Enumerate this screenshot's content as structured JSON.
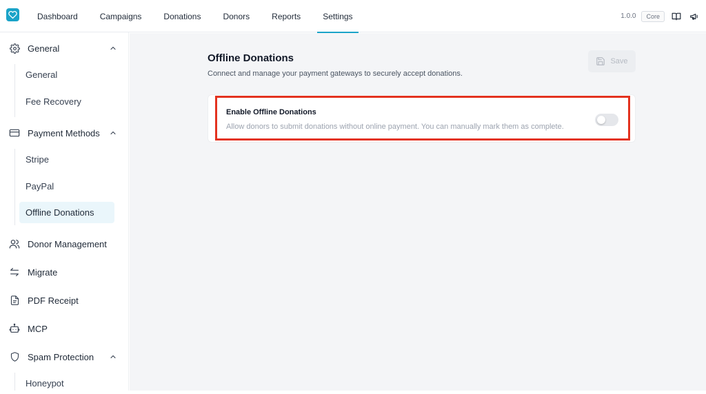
{
  "header": {
    "nav": [
      {
        "label": "Dashboard"
      },
      {
        "label": "Campaigns"
      },
      {
        "label": "Donations"
      },
      {
        "label": "Donors"
      },
      {
        "label": "Reports"
      },
      {
        "label": "Settings",
        "active": true
      }
    ],
    "version": "1.0.0",
    "badge": "Core",
    "icons": [
      "docs-book-icon",
      "megaphone-icon"
    ]
  },
  "sidebar": {
    "general": {
      "label": "General",
      "icon": "gear-icon",
      "items": [
        {
          "label": "General"
        },
        {
          "label": "Fee Recovery"
        }
      ]
    },
    "payment": {
      "label": "Payment Methods",
      "icon": "card-icon",
      "items": [
        {
          "label": "Stripe"
        },
        {
          "label": "PayPal"
        },
        {
          "label": "Offline Donations",
          "active": true
        }
      ]
    },
    "donor_management": {
      "label": "Donor Management",
      "icon": "users-icon"
    },
    "migrate": {
      "label": "Migrate",
      "icon": "swap-arrows-icon"
    },
    "pdf_receipt": {
      "label": "PDF Receipt",
      "icon": "document-icon"
    },
    "mcp": {
      "label": "MCP",
      "icon": "robot-icon"
    },
    "spam": {
      "label": "Spam Protection",
      "icon": "shield-icon",
      "items": [
        {
          "label": "Honeypot"
        }
      ]
    }
  },
  "main": {
    "title": "Offline Donations",
    "subtitle": "Connect and manage your payment gateways to securely accept donations.",
    "save_label": "Save",
    "card": {
      "title": "Enable Offline Donations",
      "description": "Allow donors to submit donations without online payment. You can manually mark them as complete.",
      "enabled": false
    }
  },
  "colors": {
    "accent": "#1aa3c8",
    "highlight": "#e3321f",
    "background": "#f4f5f7"
  }
}
